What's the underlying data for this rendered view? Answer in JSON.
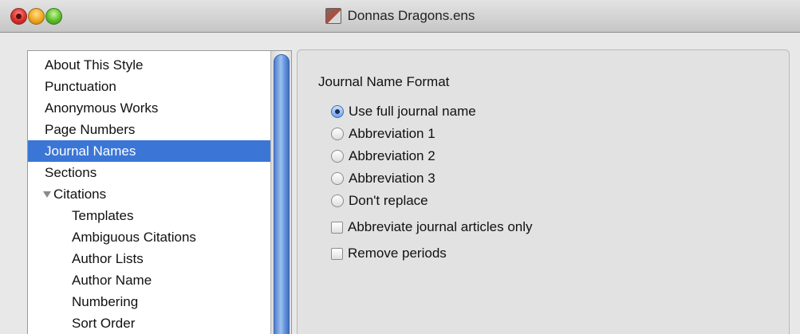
{
  "window": {
    "title": "Donnas Dragons.ens"
  },
  "sidebar": {
    "items": [
      {
        "label": "About This Style"
      },
      {
        "label": "Punctuation"
      },
      {
        "label": "Anonymous Works"
      },
      {
        "label": "Page Numbers"
      },
      {
        "label": "Journal Names",
        "selected": true
      },
      {
        "label": "Sections"
      },
      {
        "label": "Citations",
        "expanded": true
      },
      {
        "label": "Templates"
      },
      {
        "label": "Ambiguous Citations"
      },
      {
        "label": "Author Lists"
      },
      {
        "label": "Author Name"
      },
      {
        "label": "Numbering"
      },
      {
        "label": "Sort Order"
      }
    ]
  },
  "panel": {
    "section_label": "Journal Name Format",
    "radio_options": [
      {
        "label": "Use full journal name",
        "checked": true
      },
      {
        "label": "Abbreviation 1",
        "checked": false
      },
      {
        "label": "Abbreviation 2",
        "checked": false
      },
      {
        "label": "Abbreviation 3",
        "checked": false
      },
      {
        "label": "Don't replace",
        "checked": false
      }
    ],
    "checkboxes": [
      {
        "label": "Abbreviate journal articles only",
        "checked": false
      },
      {
        "label": "Remove periods",
        "checked": false
      }
    ]
  },
  "colors": {
    "selection": "#3b76d6",
    "scrollbar_thumb": "#6a98de"
  }
}
